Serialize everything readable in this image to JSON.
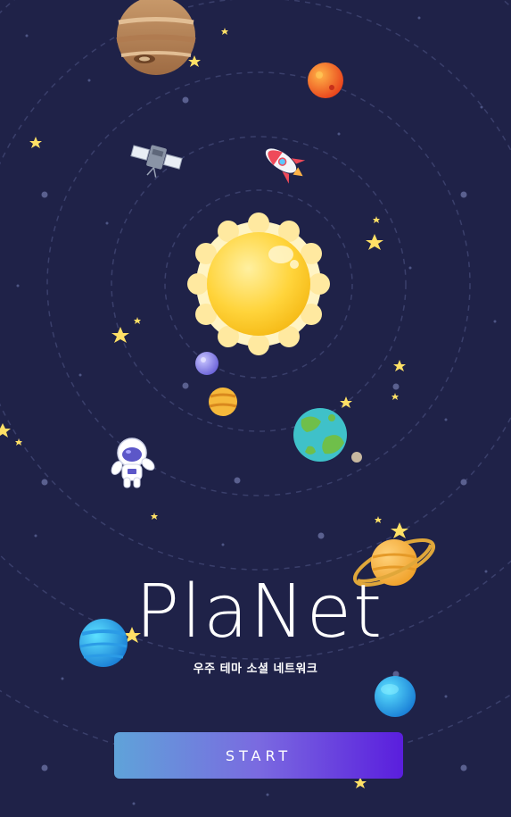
{
  "app": {
    "logo_text": "PlaNet",
    "subtitle": "우주 테마 소셜 네트워크",
    "start_label": "START"
  },
  "colors": {
    "background": "#1f2248",
    "orbit": "#3a3f6b",
    "star": "#ffe066",
    "sun": "#ffd43b",
    "button_gradient_start": "#5fa3d9",
    "button_gradient_end": "#5a1edd"
  },
  "icons": {
    "sun": "sun-icon",
    "rocket": "rocket-icon",
    "satellite": "satellite-icon",
    "astronaut": "astronaut-icon",
    "earth": "earth-icon",
    "saturn": "saturn-icon"
  }
}
